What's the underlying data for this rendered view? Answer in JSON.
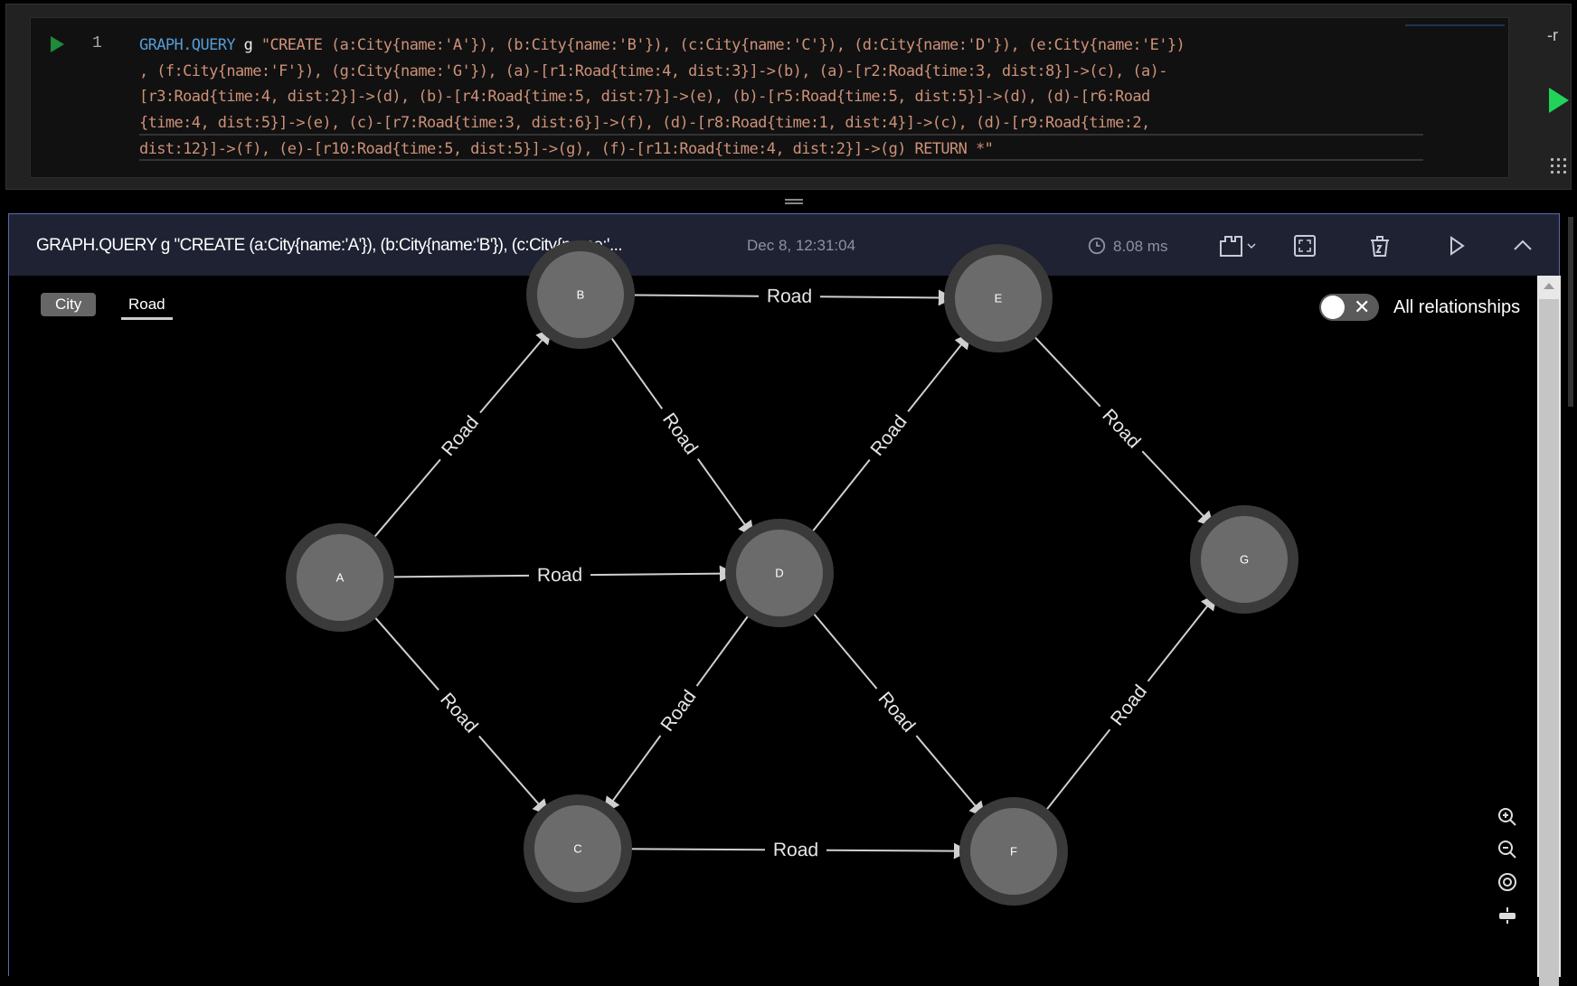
{
  "editor": {
    "line_number": "1",
    "keyword": "GRAPH.QUERY",
    "graph_key": "g",
    "lines": [
      " \"CREATE (a:City{name:'A'}), (b:City{name:'B'}), (c:City{name:'C'}), (d:City{name:'D'}), (e:City{name:'E'})",
      ", (f:City{name:'F'}), (g:City{name:'G'}), (a)-[r1:Road{time:4, dist:3}]->(b), (a)-[r2:Road{time:3, dist:8}]->(c), (a)-",
      "[r3:Road{time:4, dist:2}]->(d), (b)-[r4:Road{time:5, dist:7}]->(e), (b)-[r5:Road{time:5, dist:5}]->(d), (d)-[r6:Road",
      "{time:4, dist:5}]->(e), (c)-[r7:Road{time:3, dist:6}]->(f), (d)-[r8:Road{time:1, dist:4}]->(c), (d)-[r9:Road{time:2,",
      "dist:12}]->(f), (e)-[r10:Road{time:5, dist:5}]->(g), (f)-[r11:Road{time:4, dist:2}]->(g) RETURN *\""
    ],
    "side_label": "-r",
    "colors": {
      "keyword": "#569cd6",
      "string": "#ce9178",
      "run": "#22d35a"
    }
  },
  "result": {
    "title": "GRAPH.QUERY g \"CREATE (a:City{name:'A'}), (b:City{name:'B'}), (c:City{name:'...",
    "date": "Dec 8, 12:31:04",
    "exec_time": "8.08 ms",
    "labels": {
      "city": "City",
      "road": "Road"
    },
    "all_relationships": "All relationships",
    "all_relationships_on": false
  },
  "graph": {
    "nodes": [
      "A",
      "B",
      "C",
      "D",
      "E",
      "F",
      "G"
    ],
    "edges": [
      {
        "id": "r1",
        "from": "A",
        "to": "B",
        "label": "Road"
      },
      {
        "id": "r2",
        "from": "A",
        "to": "C",
        "label": "Road"
      },
      {
        "id": "r3",
        "from": "A",
        "to": "D",
        "label": "Road"
      },
      {
        "id": "r4",
        "from": "B",
        "to": "E",
        "label": "Road"
      },
      {
        "id": "r5",
        "from": "B",
        "to": "D",
        "label": "Road"
      },
      {
        "id": "r6",
        "from": "D",
        "to": "E",
        "label": "Road"
      },
      {
        "id": "r7",
        "from": "C",
        "to": "F",
        "label": "Road"
      },
      {
        "id": "r8",
        "from": "D",
        "to": "C",
        "label": "Road"
      },
      {
        "id": "r9",
        "from": "D",
        "to": "F",
        "label": "Road"
      },
      {
        "id": "r10",
        "from": "E",
        "to": "G",
        "label": "Road"
      },
      {
        "id": "r11",
        "from": "F",
        "to": "G",
        "label": "Road"
      }
    ],
    "colors": {
      "node": "#6b6b6b",
      "node_ring": "#3a3a3a",
      "edge": "#cfcfcf"
    }
  }
}
